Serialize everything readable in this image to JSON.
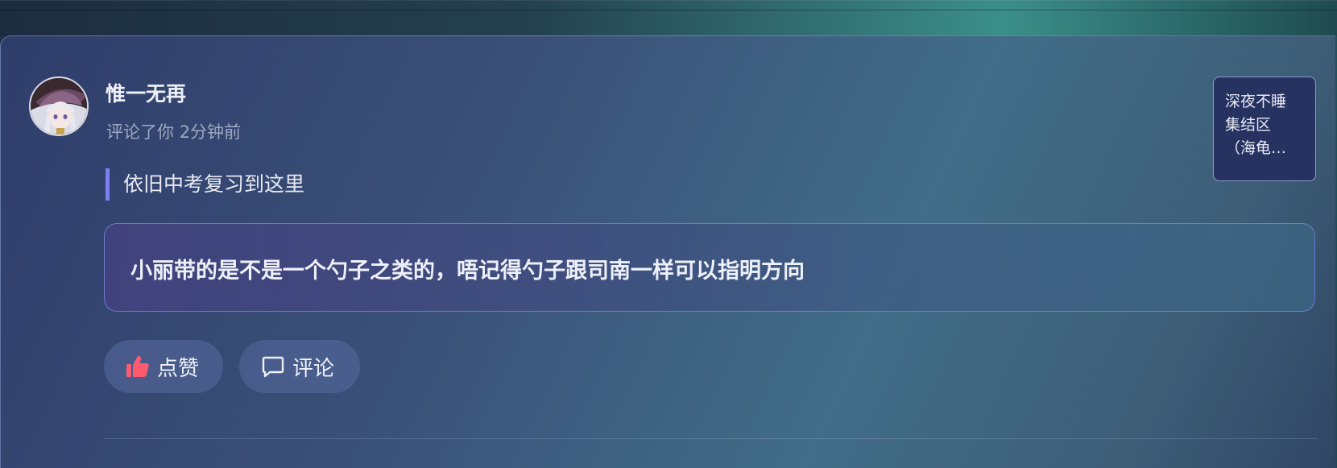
{
  "comment": {
    "username": "惟一无再",
    "action": "评论了你",
    "time": "2分钟前",
    "quoted_text": "依旧中考复习到这里",
    "body": "小丽带的是不是一个勺子之类的，唔记得勺子跟司南一样可以指明方向"
  },
  "side_card": {
    "line1": "深夜不睡",
    "line2": "集结区",
    "line3": "（海龟…"
  },
  "actions": {
    "like_label": "点赞",
    "comment_label": "评论"
  },
  "icons": {
    "like": "thumbs-up-icon",
    "comment": "speech-bubble-icon"
  },
  "colors": {
    "like_icon": "#ff5a6e",
    "quote_bar": "#7d7ff0"
  }
}
